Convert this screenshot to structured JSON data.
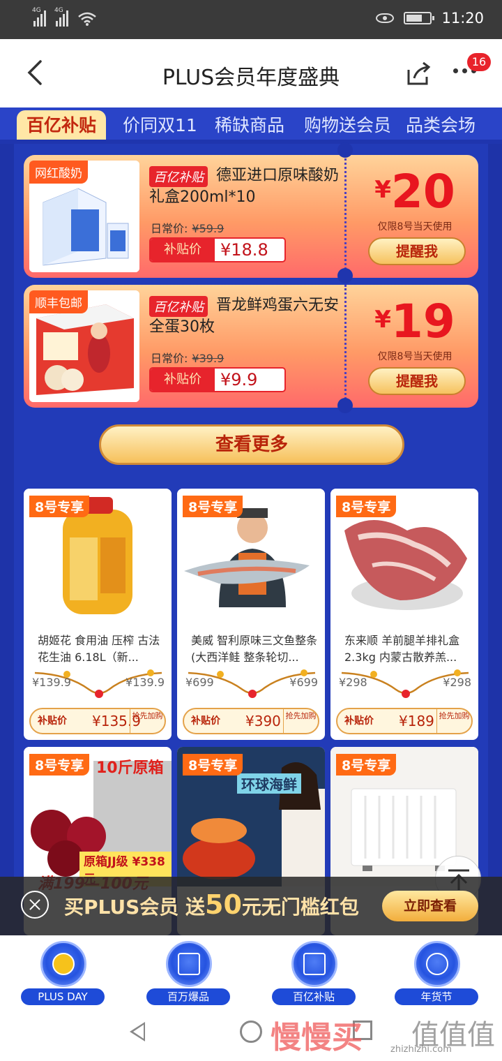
{
  "status": {
    "time": "11:20",
    "net1": "4G",
    "net2": "4G"
  },
  "header": {
    "title": "PLUS会员年度盛典",
    "badge": "16"
  },
  "tabs": [
    "百亿补贴",
    "价同双11",
    "稀缺商品",
    "购物送会员",
    "品类会场"
  ],
  "deals": [
    {
      "tag": "网红酸奶",
      "label": "百亿补贴",
      "name": "德亚进口原味酸奶礼盒200ml*10",
      "orig_label": "日常价:",
      "orig_price": "¥59.9",
      "sub_label": "补贴价",
      "sub_price": "¥18.8",
      "amount_sym": "¥",
      "amount": "20",
      "limit": "仅限8号当天使用",
      "remind": "提醒我"
    },
    {
      "tag": "顺丰包邮",
      "label": "百亿补贴",
      "name": "晋龙鲜鸡蛋六无安全蛋30枚",
      "orig_label": "日常价:",
      "orig_price": "¥39.9",
      "sub_label": "补贴价",
      "sub_price": "¥9.9",
      "amount_sym": "¥",
      "amount": "19",
      "limit": "仅限8号当天使用",
      "remind": "提醒我"
    }
  ],
  "more_button": "查看更多",
  "products": [
    {
      "badge": "8号专享",
      "title": "胡姬花 食用油 压榨 古法花生油 6.18L（新...",
      "left_price": "¥139.9",
      "right_price": "¥139.9",
      "sub_label": "补贴价",
      "sub_price": "¥135.9",
      "grab": "抢先加购"
    },
    {
      "badge": "8号专享",
      "title": "美威 智利原味三文鱼整条(大西洋鲑 整条轮切...",
      "left_price": "¥699",
      "right_price": "¥699",
      "sub_label": "补贴价",
      "sub_price": "¥390",
      "grab": "抢先加购"
    },
    {
      "badge": "8号专享",
      "title": "东来顺 羊前腿羊排礼盒2.3kg 内蒙古散养羔...",
      "left_price": "¥298",
      "right_price": "¥298",
      "sub_label": "补贴价",
      "sub_price": "¥189",
      "grab": "抢先加购"
    },
    {
      "badge": "8号专享",
      "img_text": "10斤原箱",
      "img_text2": "原箱JJ级 ¥338元",
      "img_text3": "满199—100元"
    },
    {
      "badge": "8号专享",
      "img_text": "环球海鲜"
    },
    {
      "badge": "8号专享"
    }
  ],
  "promo": {
    "pre": "买PLUS会员 送",
    "num": "50",
    "post": "元无门槛红包",
    "cta": "立即查看"
  },
  "bottom_nav": [
    {
      "label": "PLUS DAY",
      "icon": "crown-icon"
    },
    {
      "label": "百万爆品",
      "icon": "box-icon"
    },
    {
      "label": "百亿补贴",
      "icon": "coupon-icon"
    },
    {
      "label": "年货节",
      "icon": "newyear-icon"
    }
  ],
  "watermark": {
    "w1": "慢慢买",
    "w2": "值值值",
    "w3": "zhizhizhi.com"
  }
}
